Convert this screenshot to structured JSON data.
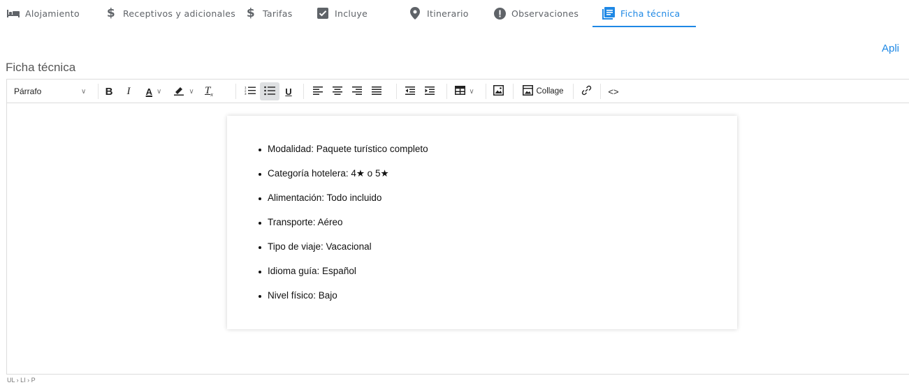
{
  "tabs": [
    {
      "label": "Alojamiento",
      "icon": "bed-icon"
    },
    {
      "label": "Receptivos y adicionales",
      "icon": "dollar-icon"
    },
    {
      "label": "Tarifas",
      "icon": "dollar-icon"
    },
    {
      "label": "Incluye",
      "icon": "checkbox-icon"
    },
    {
      "label": "Itinerario",
      "icon": "location-pin-icon"
    },
    {
      "label": "Observaciones",
      "icon": "alert-circle-icon"
    },
    {
      "label": "Ficha técnica",
      "icon": "document-icon",
      "active": true
    }
  ],
  "apply_link": "Apli",
  "section_title": "Ficha técnica",
  "editor": {
    "format_select": "Párrafo",
    "collage_label": "Collage",
    "content_items": [
      "Modalidad: Paquete turístico completo",
      "Categoría hotelera: 4★ o 5★",
      "Alimentación: Todo incluido",
      "Transporte: Aéreo",
      "Tipo de viaje: Vacacional",
      "Idioma guía: Español",
      "Nivel físico: Bajo"
    ],
    "status_path": "UL › LI › P"
  },
  "colors": {
    "accent": "#1e88e5",
    "text": "#5f6368"
  }
}
